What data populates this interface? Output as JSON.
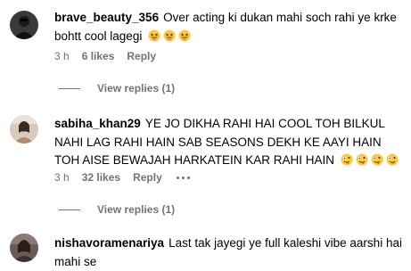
{
  "comments": [
    {
      "username": "brave_beauty_356",
      "text": "Over acting ki dukan mahi soch rahi ye krke bohtt cool lagegi",
      "emojis": [
        "grinning-squinting-face",
        "grinning-squinting-face",
        "grinning-squinting-face"
      ],
      "time": "3 h",
      "likes": "6 likes",
      "reply_label": "Reply",
      "view_replies": "View replies (1)"
    },
    {
      "username": "sabiha_khan29",
      "text": "YE JO DIKHA RAHI HAI COOL TOH BILKUL NAHI LAG RAHI HAIN SAB SEASONS DEKH KE AAYI HAIN TOH AISE BEWAJAH HARKATEIN KAR RAHI HAIN",
      "emojis": [
        "zany-face",
        "zany-face",
        "zany-face",
        "zany-face"
      ],
      "time": "3 h",
      "likes": "32 likes",
      "reply_label": "Reply",
      "view_replies": "View replies (1)"
    },
    {
      "username": "nishavoramenariya",
      "text": "Last tak jayegi ye full kaleshi vibe aarshi hai mahi se",
      "time": "",
      "likes": "",
      "reply_label": "",
      "view_replies": ""
    }
  ],
  "colors": {
    "meta_gray": "#737373",
    "text": "#000000"
  }
}
